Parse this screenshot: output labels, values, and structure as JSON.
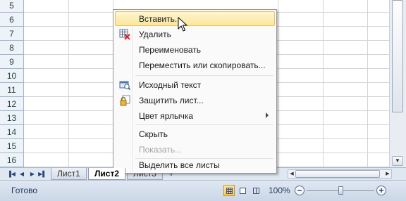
{
  "grid": {
    "rows": [
      "5",
      "6",
      "7",
      "8",
      "9",
      "10",
      "11",
      "12",
      "13",
      "14",
      "15",
      "16"
    ]
  },
  "context_menu": {
    "items": [
      {
        "label": "Вставить...",
        "state": "hover",
        "icon": "none"
      },
      {
        "label": "Удалить",
        "state": "normal",
        "icon": "delete-sheet-icon"
      },
      {
        "label": "Переименовать",
        "state": "normal",
        "icon": "none"
      },
      {
        "label": "Переместить или скопировать...",
        "state": "normal",
        "icon": "none"
      },
      {
        "label": "Исходный текст",
        "state": "normal",
        "icon": "view-code-icon"
      },
      {
        "label": "Защитить лист...",
        "state": "normal",
        "icon": "protect-sheet-icon"
      },
      {
        "label": "Цвет ярлычка",
        "state": "normal",
        "icon": "none",
        "submenu": true
      },
      {
        "label": "Скрыть",
        "state": "normal",
        "icon": "none"
      },
      {
        "label": "Показать...",
        "state": "disabled",
        "icon": "none"
      },
      {
        "label": "Выделить все листы",
        "state": "normal",
        "icon": "none"
      }
    ]
  },
  "sheet_tabs": {
    "tabs": [
      "Лист1",
      "Лист2",
      "Лист3"
    ],
    "active": "Лист2"
  },
  "status_bar": {
    "status": "Готово",
    "zoom": "100%",
    "zoom_minus": "−",
    "zoom_plus": "+"
  },
  "colors": {
    "menu_hover": "#fbe69a",
    "active_view": "#f9c552"
  }
}
